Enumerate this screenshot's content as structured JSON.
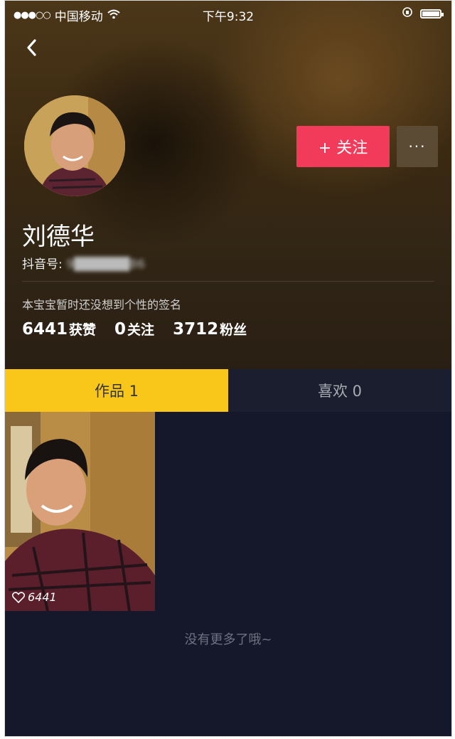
{
  "statusbar": {
    "signal": "●●●○○",
    "carrier": "中国移动",
    "time": "下午9:32"
  },
  "profile": {
    "name": "刘德华",
    "douyin_id_label": "抖音号:",
    "douyin_id_value": "9██████86",
    "signature": "本宝宝暂时还没想到个性的签名",
    "follow_label": "+ 关注",
    "more_label": "···"
  },
  "stats": [
    {
      "value": "6441",
      "label": "获赞"
    },
    {
      "value": "0",
      "label": "关注"
    },
    {
      "value": "3712",
      "label": "粉丝"
    }
  ],
  "tabs": [
    {
      "label": "作品 1",
      "active": true
    },
    {
      "label": "喜欢 0",
      "active": false
    }
  ],
  "works": [
    {
      "likes": "6441"
    }
  ],
  "footer_text": "没有更多了哦~",
  "colors": {
    "accent": "#f23b5a",
    "tab_active": "#f9c61a",
    "background": "#15172a"
  }
}
